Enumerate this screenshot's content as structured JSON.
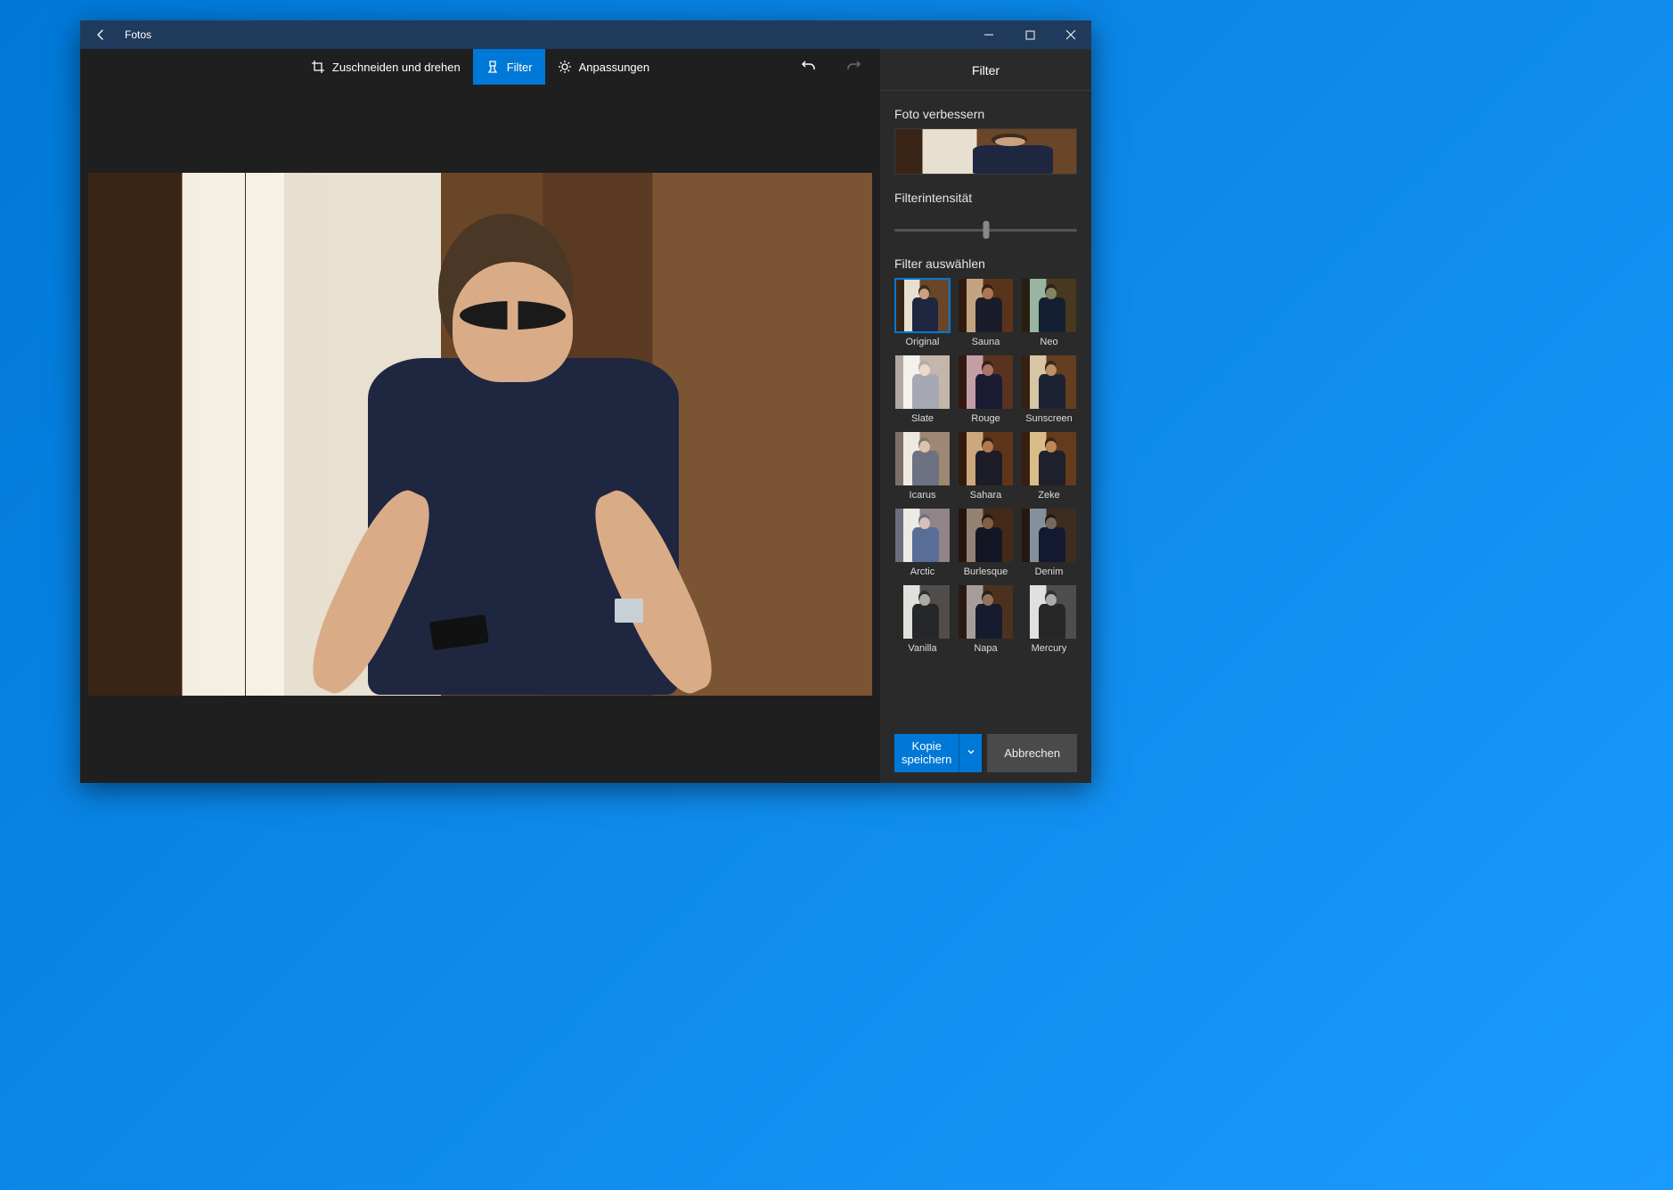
{
  "appTitle": "Fotos",
  "tabs": {
    "crop": "Zuschneiden und drehen",
    "filter": "Filter",
    "adjust": "Anpassungen",
    "active": "filter"
  },
  "panel": {
    "title": "Filter",
    "enhance": "Foto verbessern",
    "intensity": "Filterintensität",
    "choose": "Filter auswählen",
    "intensity_value": 50
  },
  "filters": [
    {
      "id": "original",
      "name": "Original",
      "selected": true,
      "tint": "",
      "mode": ""
    },
    {
      "id": "sauna",
      "name": "Sauna",
      "tint": "rgba(180,120,70,0.5)",
      "mode": "multiply"
    },
    {
      "id": "neo",
      "name": "Neo",
      "tint": "rgba(80,160,140,0.5)",
      "mode": "multiply"
    },
    {
      "id": "slate",
      "name": "Slate",
      "tint": "rgba(220,220,220,0.7)",
      "mode": "screen"
    },
    {
      "id": "rouge",
      "name": "Rouge",
      "tint": "rgba(170,90,140,0.45)",
      "mode": "multiply"
    },
    {
      "id": "sunscreen",
      "name": "Sunscreen",
      "tint": "rgba(220,200,150,0.5)",
      "mode": "multiply"
    },
    {
      "id": "icarus",
      "name": "Icarus",
      "tint": "rgba(255,255,255,0.35)",
      "mode": "screen"
    },
    {
      "id": "sahara",
      "name": "Sahara",
      "tint": "rgba(200,140,70,0.55)",
      "mode": "multiply"
    },
    {
      "id": "zeke",
      "name": "Zeke",
      "tint": "rgba(230,180,100,0.55)",
      "mode": "multiply"
    },
    {
      "id": "arctic",
      "name": "Arctic",
      "tint": "rgba(130,170,230,0.5)",
      "mode": "screen"
    },
    {
      "id": "burlesque",
      "name": "Burlesque",
      "tint": "rgba(90,60,50,0.55)",
      "mode": "multiply"
    },
    {
      "id": "denim",
      "name": "Denim",
      "tint": "rgba(60,90,140,0.55)",
      "mode": "multiply"
    },
    {
      "id": "vanilla",
      "name": "Vanilla",
      "tint": "rgba(100,100,100,0.9)",
      "mode": "saturation"
    },
    {
      "id": "napa",
      "name": "Napa",
      "tint": "rgba(50,40,70,0.35)",
      "mode": "multiply"
    },
    {
      "id": "mercury",
      "name": "Mercury",
      "tint": "rgba(40,40,40,1)",
      "mode": "saturation"
    }
  ],
  "footer": {
    "saveCopy": "Kopie speichern",
    "cancel": "Abbrechen"
  },
  "colors": {
    "accent": "#0078d7"
  }
}
